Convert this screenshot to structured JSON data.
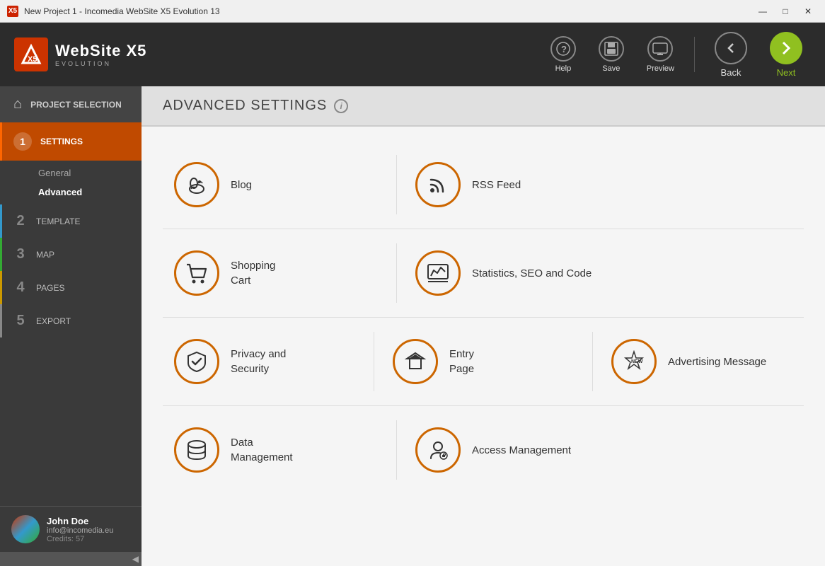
{
  "titlebar": {
    "title": "New Project 1 - Incomedia WebSite X5 Evolution 13",
    "icon": "X5",
    "min": "—",
    "max": "□",
    "close": "✕"
  },
  "toolbar": {
    "logo_brand": "WebSite X5",
    "logo_sub": "EVOLUTION",
    "logo_icon": "X5",
    "help_label": "Help",
    "save_label": "Save",
    "preview_label": "Preview",
    "back_label": "Back",
    "next_label": "Next"
  },
  "sidebar": {
    "home_label": "PROJECT SELECTION",
    "steps": [
      {
        "num": "1",
        "label": "SETTINGS",
        "active": true
      },
      {
        "num": "2",
        "label": "TEMPLATE"
      },
      {
        "num": "3",
        "label": "MAP"
      },
      {
        "num": "4",
        "label": "PAGES"
      },
      {
        "num": "5",
        "label": "EXPORT"
      }
    ],
    "sub_nav": [
      {
        "label": "General",
        "active": false
      },
      {
        "label": "Advanced",
        "active": true
      }
    ],
    "user": {
      "name": "John Doe",
      "email": "info@incomedia.eu",
      "credits": "Credits: 57"
    }
  },
  "page": {
    "title": "ADVANCED SETTINGS",
    "info_icon": "i"
  },
  "tiles": [
    {
      "row": 0,
      "items": [
        {
          "id": "blog",
          "label": "Blog"
        },
        {
          "id": "rss",
          "label": "RSS Feed"
        }
      ]
    },
    {
      "row": 1,
      "items": [
        {
          "id": "shopping_cart",
          "label": "Shopping Cart"
        },
        {
          "id": "statistics",
          "label": "Statistics, SEO and Code"
        }
      ]
    },
    {
      "row": 2,
      "items": [
        {
          "id": "privacy",
          "label": "Privacy and Security"
        },
        {
          "id": "entry_page",
          "label": "Entry Page"
        },
        {
          "id": "advertising",
          "label": "Advertising Message"
        }
      ]
    },
    {
      "row": 3,
      "items": [
        {
          "id": "data_management",
          "label": "Data Management"
        },
        {
          "id": "access_management",
          "label": "Access Management"
        }
      ]
    }
  ]
}
